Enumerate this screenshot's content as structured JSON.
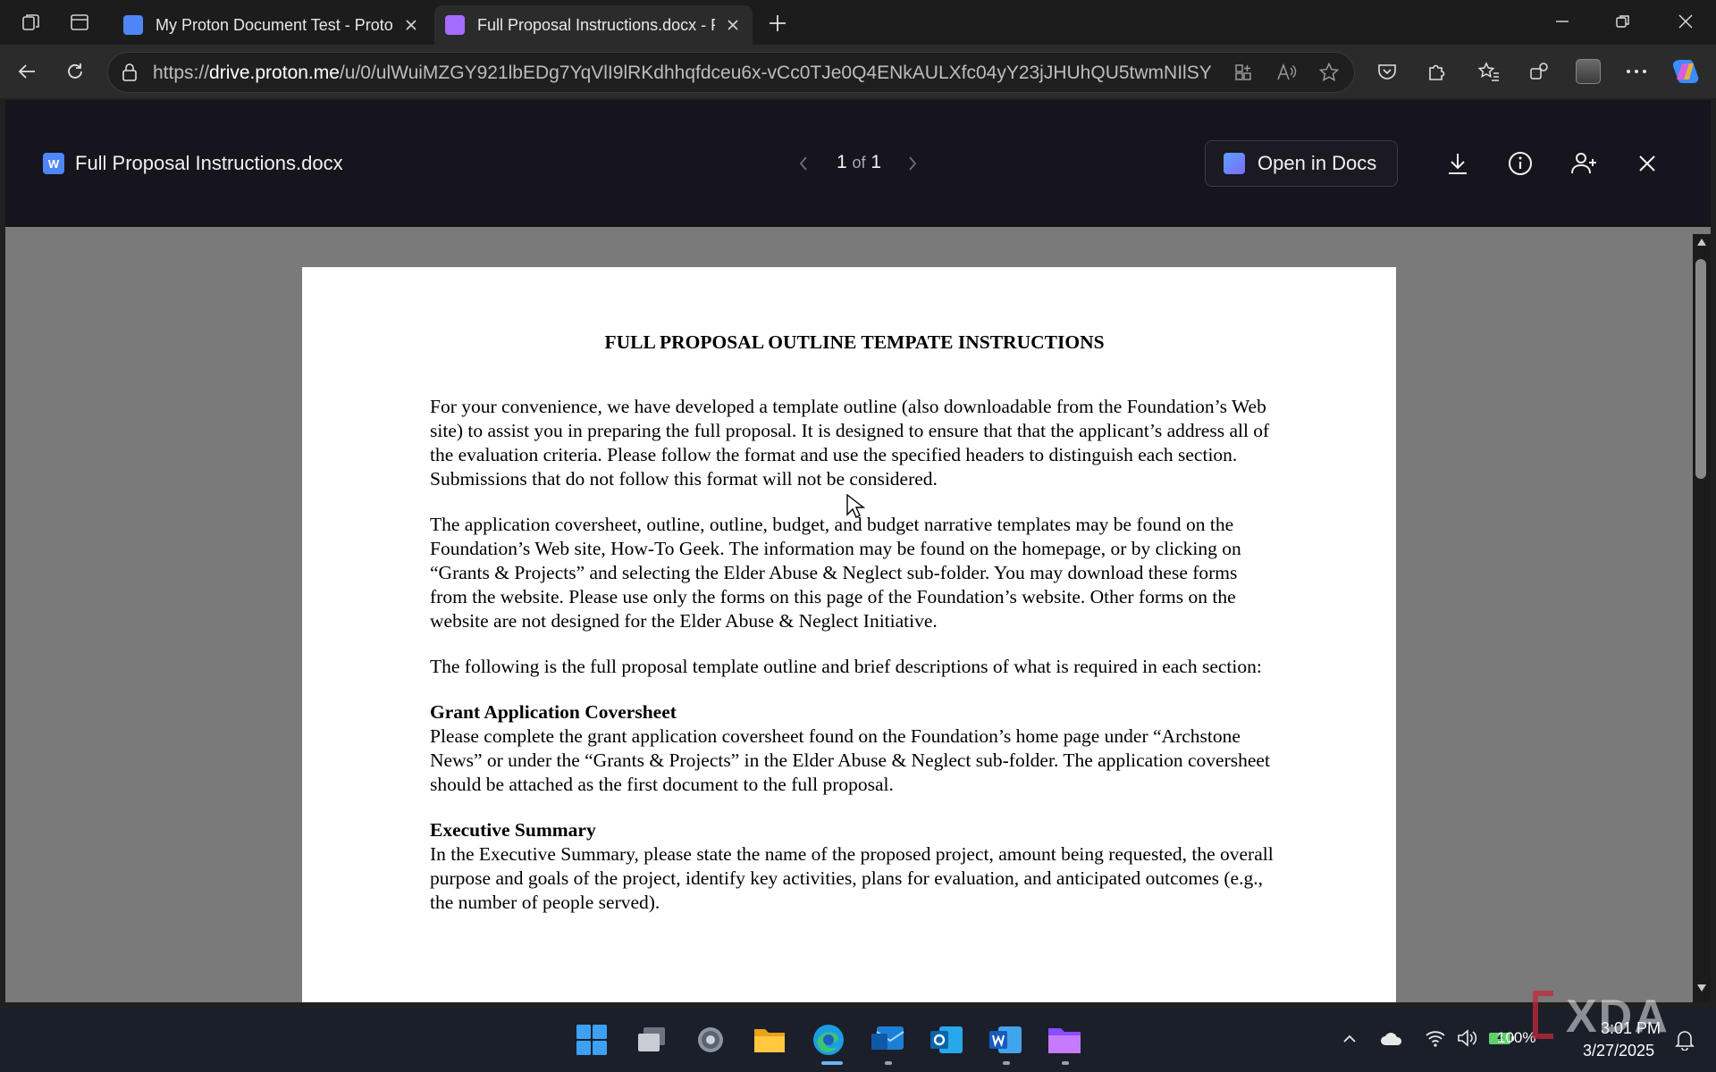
{
  "browser": {
    "tabs": [
      {
        "title": "My Proton Document Test - Proto",
        "active": false
      },
      {
        "title": "Full Proposal Instructions.docx - P",
        "active": true
      }
    ],
    "url_prefix": "https://",
    "url_host": "drive.proton.me",
    "url_rest": "/u/0/ulWuiMZGY921lbEDg7YqVlI9lRKdhhqfdceu6x-vCc0TJe0Q4ENkAULXfc04yY23jJHUhQU5twmNIlSY3..."
  },
  "viewer": {
    "file_badge": "W",
    "file_name": "Full Proposal Instructions.docx",
    "page_current": "1",
    "page_of": "of",
    "page_total": "1",
    "open_in_docs_label": "Open in Docs"
  },
  "document": {
    "title": "FULL PROPOSAL OUTLINE TEMPATE INSTRUCTIONS",
    "p1": "For your convenience, we have developed a template outline (also downloadable from the Foundation’s Web site) to assist you in preparing the full proposal.  It is designed to ensure that that the applicant’s address all of the evaluation criteria.  Please follow the format and use the specified headers to distinguish each section.  Submissions that do not follow this format will not be considered.",
    "p2": "The application coversheet, outline, outline, budget, and budget narrative templates may be found on the Foundation’s Web site, How-To Geek.  The information may be found on the homepage, or by clicking on “Grants & Projects” and selecting the Elder Abuse & Neglect sub-folder.  You may download these forms from the website.  Please use only the forms on this page of the Foundation’s website.  Other forms on the website are not designed for the Elder Abuse & Neglect Initiative.",
    "p3": "The following is the full proposal template outline and brief descriptions of what is required in each section:",
    "s1_heading": "Grant Application Coversheet",
    "s1_body": "Please complete the grant application coversheet found on the Foundation’s home page under “Archstone News” or under the “Grants & Projects” in the Elder Abuse & Neglect sub-folder. The application coversheet should be attached as the first document to the full proposal.",
    "s2_heading": "Executive Summary",
    "s2_body": "In the Executive Summary, please state the name of the proposed project, amount being requested, the overall purpose and goals of the project, identify key activities, plans for evaluation, and anticipated outcomes (e.g., the number of people served)."
  },
  "taskbar": {
    "battery": "100%",
    "time": "3:01 PM",
    "date": "3/27/2025"
  },
  "watermark": "XDA",
  "colors": {
    "tab_active": "#2b2b2b",
    "viewer_header": "#16141c",
    "viewer_bg": "#7a7a7a",
    "proton_purple": "#6d4aff"
  }
}
